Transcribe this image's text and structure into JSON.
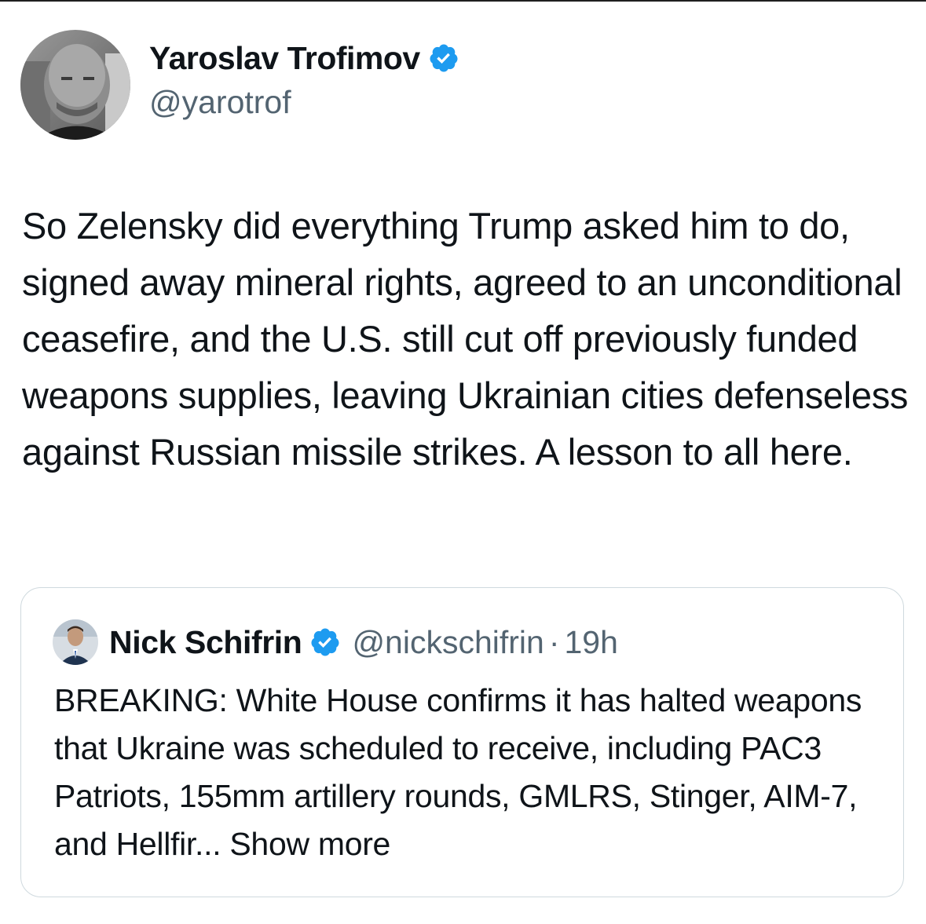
{
  "author": {
    "display_name": "Yaroslav Trofimov",
    "handle": "@yarotrof",
    "verified_icon": "verified-badge-icon",
    "avatar_description": "avatar-photo"
  },
  "tweet": {
    "text": "So Zelensky did everything Trump asked him to do, signed away mineral rights, agreed to an unconditional ceasefire, and the U.S. still cut off previously funded weapons supplies, leaving Ukrainian cities defenseless against Russian missile strikes. A lesson to all here."
  },
  "quoted_tweet": {
    "display_name": "Nick Schifrin",
    "handle": "@nickschifrin",
    "separator": "·",
    "time": "19h",
    "text": "BREAKING: White House confirms it has halted weapons that Ukraine was scheduled to receive, including PAC3 Patriots, 155mm artillery rounds, GMLRS, Stinger, AIM-7, and Hellfir...",
    "show_more_label": "Show more"
  },
  "colors": {
    "text_primary": "#0f1419",
    "text_secondary": "#536471",
    "verified_blue": "#1d9bf0",
    "card_border": "#cfd9de"
  }
}
